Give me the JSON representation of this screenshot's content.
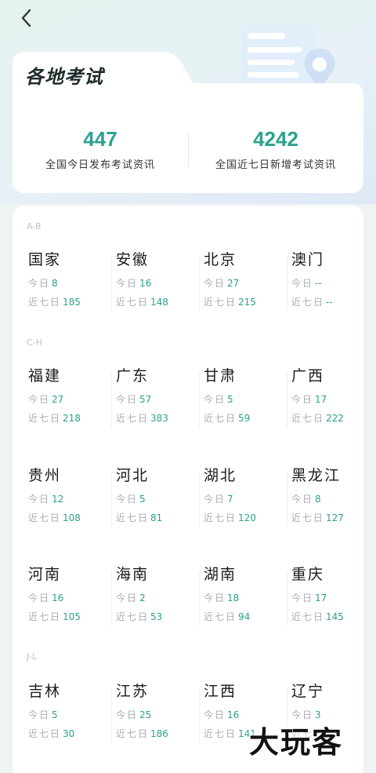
{
  "header": {
    "back_icon": "chevron-left-icon",
    "title": "各地考试"
  },
  "stats": [
    {
      "value": "447",
      "label": "全国今日发布考试资讯"
    },
    {
      "value": "4242",
      "label": "全国近七日新增考试资讯"
    }
  ],
  "labels": {
    "today": "今日",
    "week": "近七日"
  },
  "groups": [
    {
      "label": "A-B",
      "regions": [
        {
          "name": "国家",
          "today": "8",
          "week": "185"
        },
        {
          "name": "安徽",
          "today": "16",
          "week": "148"
        },
        {
          "name": "北京",
          "today": "27",
          "week": "215"
        },
        {
          "name": "澳门",
          "today": "--",
          "week": "--"
        }
      ]
    },
    {
      "label": "C-H",
      "regions": [
        {
          "name": "福建",
          "today": "27",
          "week": "218"
        },
        {
          "name": "广东",
          "today": "57",
          "week": "383"
        },
        {
          "name": "甘肃",
          "today": "5",
          "week": "59"
        },
        {
          "name": "广西",
          "today": "17",
          "week": "222"
        },
        {
          "name": "贵州",
          "today": "12",
          "week": "108"
        },
        {
          "name": "河北",
          "today": "5",
          "week": "81"
        },
        {
          "name": "湖北",
          "today": "7",
          "week": "120"
        },
        {
          "name": "黑龙江",
          "today": "8",
          "week": "127"
        },
        {
          "name": "河南",
          "today": "16",
          "week": "105"
        },
        {
          "name": "海南",
          "today": "2",
          "week": "53"
        },
        {
          "name": "湖南",
          "today": "18",
          "week": "94"
        },
        {
          "name": "重庆",
          "today": "17",
          "week": "145"
        }
      ]
    },
    {
      "label": "J-L",
      "regions": [
        {
          "name": "吉林",
          "today": "5",
          "week": "30"
        },
        {
          "name": "江苏",
          "today": "25",
          "week": "186"
        },
        {
          "name": "江西",
          "today": "16",
          "week": "141"
        },
        {
          "name": "辽宁",
          "today": "3",
          "week": ""
        }
      ]
    }
  ],
  "watermark": "大玩客",
  "colors": {
    "accent": "#2aa18e",
    "muted": "#a9adb0"
  }
}
